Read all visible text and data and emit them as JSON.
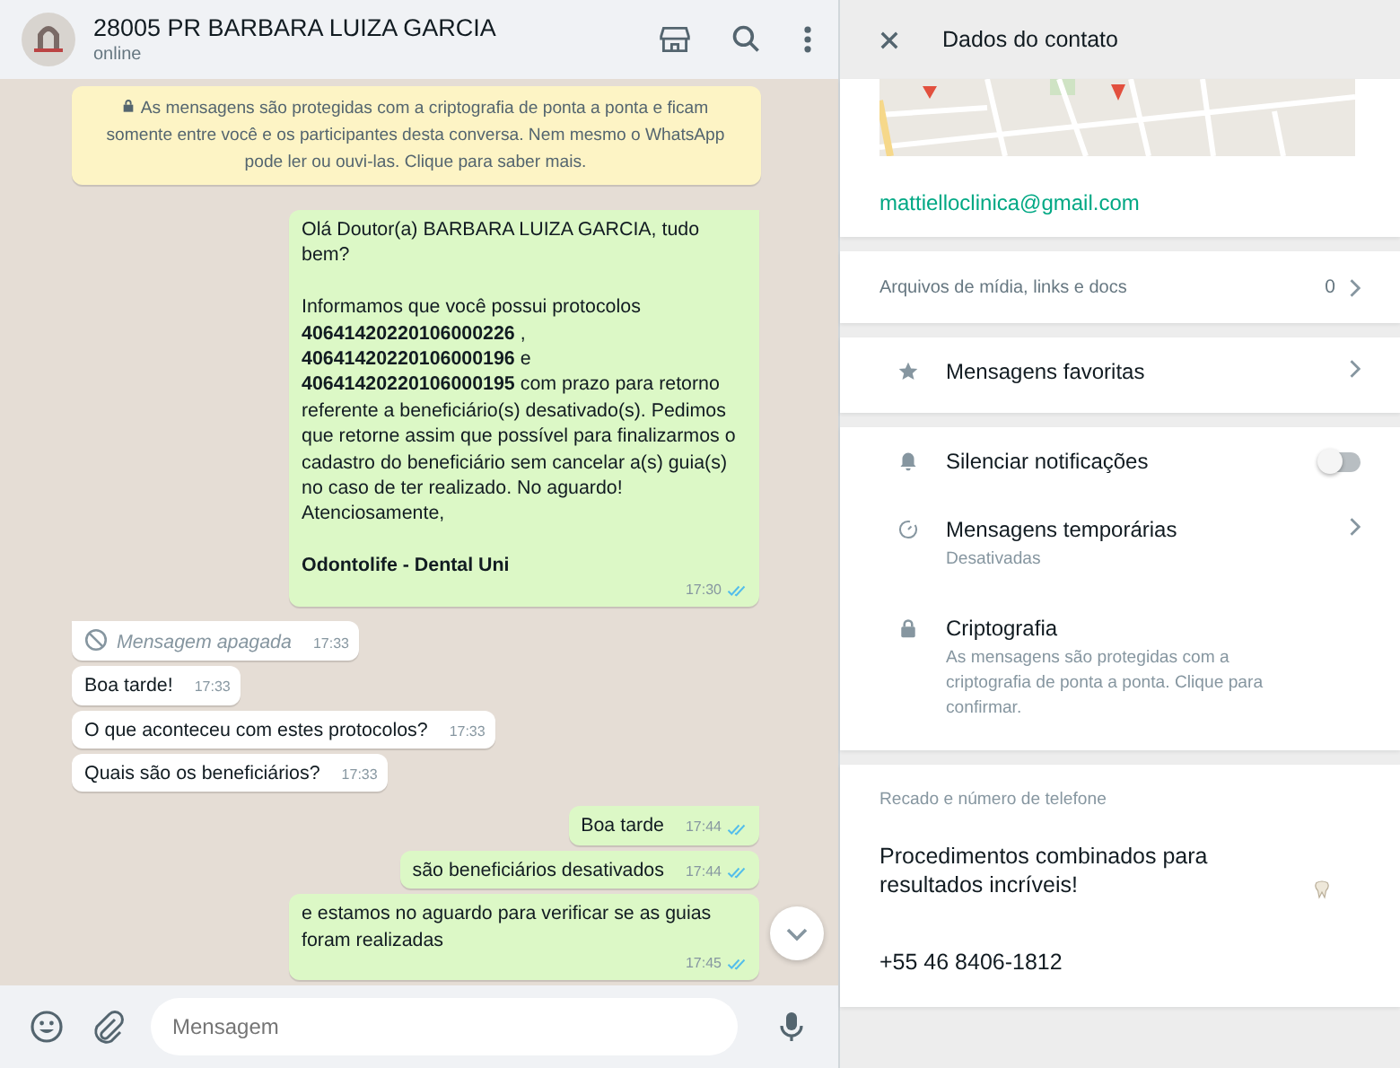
{
  "header": {
    "name": "28005 PR BARBARA LUIZA GARCIA",
    "status": "online"
  },
  "messages": [
    {
      "kind": "system",
      "text": "As mensagens são protegidas com a criptografia de ponta a ponta e ficam somente entre você e os participantes desta conversa. Nem mesmo o WhatsApp pode ler ou ouvi-las. Clique para saber mais."
    },
    {
      "kind": "out",
      "tail": true,
      "text": "Olá Doutor(a) BARBARA LUIZA GARCIA, tudo bem?\n\nInformamos que você possui protocolos **40641420220106000226** ,\n**40641420220106000196** e\n**40641420220106000195** com prazo para retorno referente a beneficiário(s) desativado(s). Pedimos que retorne assim que possível para finalizarmos o cadastro do beneficiário sem cancelar a(s) guia(s) no caso de ter realizado. No aguardo!\nAtenciosamente,\n\n**Odontolife - Dental Uni**",
      "time": "17:30",
      "read": true
    },
    {
      "kind": "deleted",
      "tail": true,
      "text": "Mensagem apagada",
      "time": "17:33"
    },
    {
      "kind": "in",
      "tail": false,
      "text": "Boa tarde!",
      "time": "17:33"
    },
    {
      "kind": "in",
      "tail": false,
      "text": "O que aconteceu com estes protocolos?",
      "time": "17:33"
    },
    {
      "kind": "in",
      "tail": false,
      "text": "Quais são os beneficiários?",
      "time": "17:33"
    },
    {
      "kind": "out",
      "tail": true,
      "text": "Boa tarde",
      "time": "17:44",
      "read": true
    },
    {
      "kind": "out",
      "tail": false,
      "text": "são beneficiários desativados",
      "time": "17:44",
      "read": true
    },
    {
      "kind": "out",
      "tail": false,
      "text": "e estamos no aguardo para verificar se as guias foram realizadas",
      "time": "17:45",
      "read": true
    }
  ],
  "composer": {
    "placeholder": "Mensagem"
  },
  "contact_panel": {
    "title": "Dados do contato",
    "email": "mattielloclinica@gmail.com",
    "media": {
      "label": "Arquivos de mídia, links e docs",
      "count": "0"
    },
    "starred": {
      "label": "Mensagens favoritas"
    },
    "mute": {
      "label": "Silenciar notificações",
      "on": false
    },
    "disappearing": {
      "label": "Mensagens temporárias",
      "subtitle": "Desativadas"
    },
    "encryption": {
      "label": "Criptografia",
      "description": "As mensagens são protegidas com a criptografia de ponta a ponta. Clique para confirmar."
    },
    "about": {
      "heading": "Recado e número de telefone",
      "text": "Procedimentos combinados para resultados incríveis!",
      "phone": "+55 46 8406-1812"
    }
  }
}
